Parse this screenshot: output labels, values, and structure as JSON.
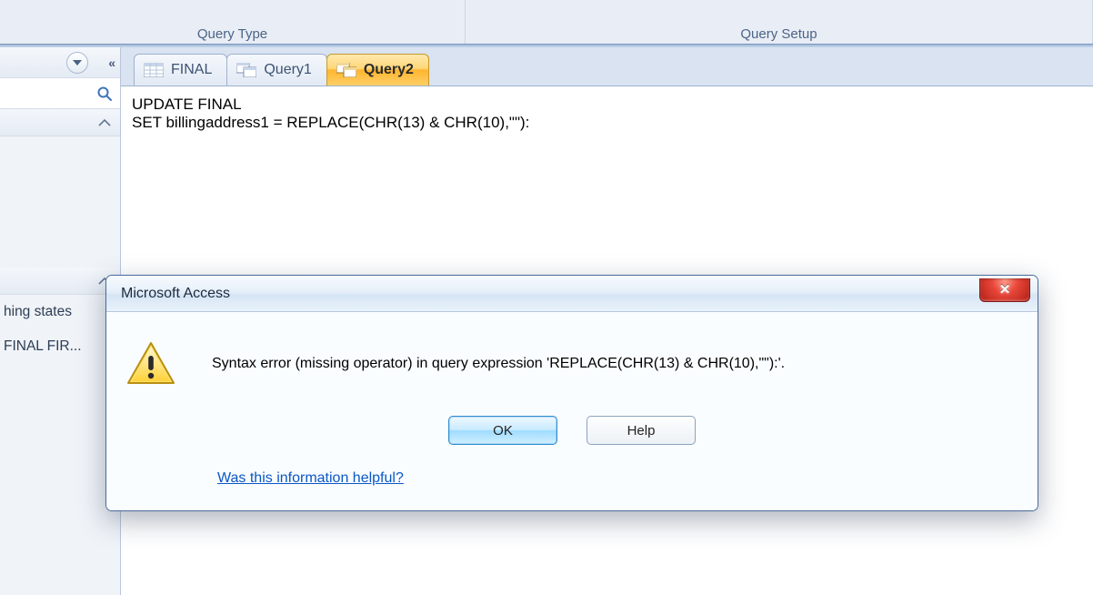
{
  "ribbon": {
    "group_query_type": "Query Type",
    "group_query_setup": "Query Setup"
  },
  "nav": {
    "items": [
      {
        "label": "hing states"
      },
      {
        "label": "FINAL FIR..."
      }
    ]
  },
  "tabs": [
    {
      "label": "FINAL",
      "active": false
    },
    {
      "label": "Query1",
      "active": false
    },
    {
      "label": "Query2",
      "active": true
    }
  ],
  "sql": "UPDATE FINAL\nSET billingaddress1 = REPLACE(CHR(13) & CHR(10),\"\"):",
  "dialog": {
    "title": "Microsoft Access",
    "message": "Syntax error (missing operator) in query expression 'REPLACE(CHR(13) & CHR(10),\"\"):'.",
    "ok": "OK",
    "help": "Help",
    "helpful": "Was this information helpful?"
  }
}
